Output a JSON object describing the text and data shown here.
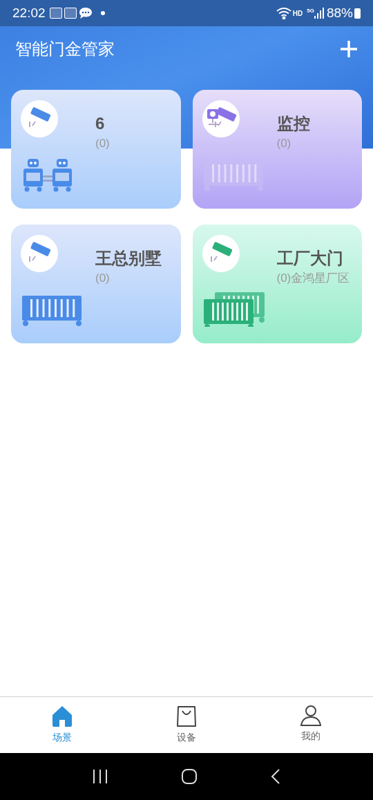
{
  "status_bar": {
    "time": "22:02",
    "network_label": "HD",
    "network_type": "5G",
    "battery": "88%"
  },
  "header": {
    "title": "智能门金管家"
  },
  "cards": [
    {
      "title": "6",
      "subtitle": "(0)"
    },
    {
      "title": "监控",
      "subtitle": "(0)"
    },
    {
      "title": "王总别墅",
      "subtitle": "(0)"
    },
    {
      "title": "工厂大门",
      "subtitle": "(0)金鸿星厂区"
    }
  ],
  "tabs": [
    {
      "label": "场景",
      "selected": true
    },
    {
      "label": "设备",
      "selected": false
    },
    {
      "label": "我的",
      "selected": false
    }
  ]
}
